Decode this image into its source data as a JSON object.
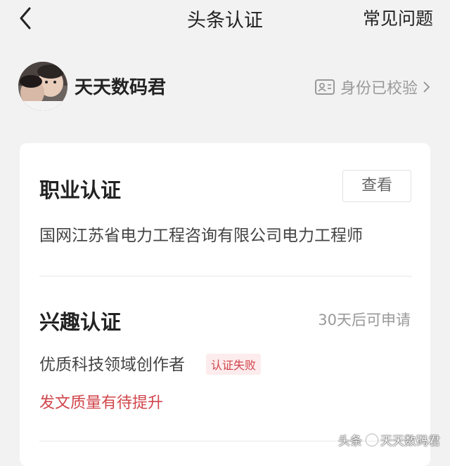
{
  "nav": {
    "title": "头条认证",
    "faq_label": "常见问题",
    "back_icon": "chevron-left-icon"
  },
  "profile": {
    "username": "天天数码君",
    "verify_label": "身份已校验",
    "id_icon": "id-card-icon"
  },
  "professional": {
    "title": "职业认证",
    "view_label": "查看",
    "description": "国网江苏省电力工程咨询有限公司电力工程师"
  },
  "interest": {
    "title": "兴趣认证",
    "apply_hint": "30天后可申请",
    "field": "优质科技领域创作者",
    "status_badge": "认证失败",
    "reason": "发文质量有待提升"
  },
  "watermark": {
    "prefix": "头条",
    "name": "天天数码君"
  },
  "colors": {
    "background": "#f2f2f2",
    "card": "#ffffff",
    "error": "#d0454b",
    "muted": "#999999"
  }
}
